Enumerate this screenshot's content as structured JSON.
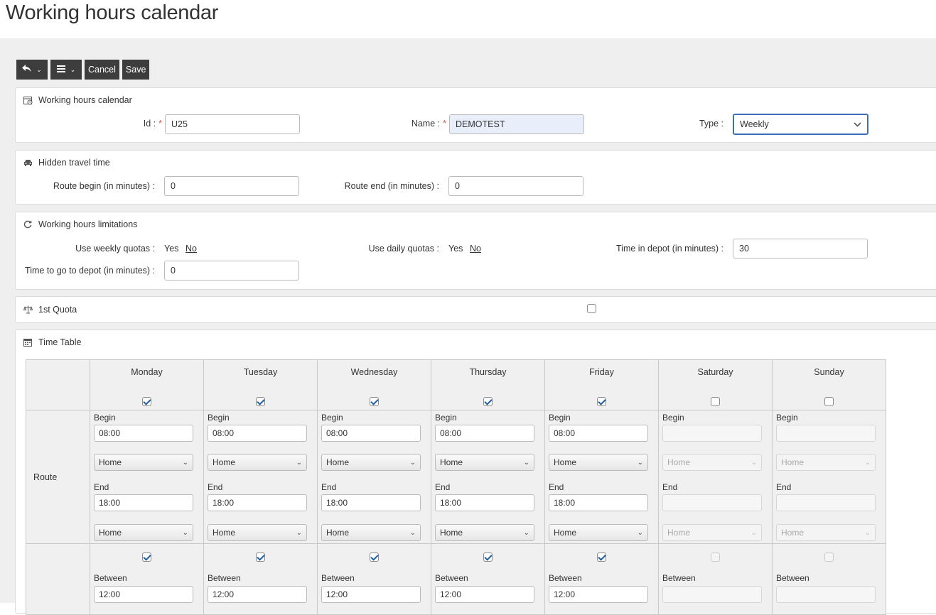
{
  "page": {
    "title": "Working hours calendar"
  },
  "toolbar": {
    "cancel": "Cancel",
    "save": "Save"
  },
  "general": {
    "title": "Working hours calendar",
    "id_label": "Id :",
    "id_value": "U25",
    "name_label": "Name :",
    "name_value": "DEMOTEST",
    "type_label": "Type :",
    "type_value": "Weekly"
  },
  "travel": {
    "title": "Hidden travel time",
    "route_begin_label": "Route begin (in minutes) :",
    "route_begin_value": "0",
    "route_end_label": "Route end (in minutes) :",
    "route_end_value": "0"
  },
  "limits": {
    "title": "Working hours limitations",
    "weekly_label": "Use weekly quotas :",
    "daily_label": "Use daily quotas :",
    "yes": "Yes",
    "no": "No",
    "depot_label": "Time in depot (in minutes) :",
    "depot_value": "30",
    "go_depot_label": "Time to go to depot (in minutes) :",
    "go_depot_value": "0"
  },
  "quota": {
    "title": "1st Quota",
    "checked": false
  },
  "timetable": {
    "title": "Time Table",
    "route_label": "Route",
    "begin_label": "Begin",
    "end_label": "End",
    "between_label": "Between",
    "days": [
      {
        "name": "Monday",
        "enabled": true,
        "begin": "08:00",
        "begin_loc": "Home",
        "end": "18:00",
        "end_loc": "Home",
        "break": "12:00"
      },
      {
        "name": "Tuesday",
        "enabled": true,
        "begin": "08:00",
        "begin_loc": "Home",
        "end": "18:00",
        "end_loc": "Home",
        "break": "12:00"
      },
      {
        "name": "Wednesday",
        "enabled": true,
        "begin": "08:00",
        "begin_loc": "Home",
        "end": "18:00",
        "end_loc": "Home",
        "break": "12:00"
      },
      {
        "name": "Thursday",
        "enabled": true,
        "begin": "08:00",
        "begin_loc": "Home",
        "end": "18:00",
        "end_loc": "Home",
        "break": "12:00"
      },
      {
        "name": "Friday",
        "enabled": true,
        "begin": "08:00",
        "begin_loc": "Home",
        "end": "18:00",
        "end_loc": "Home",
        "break": "12:00"
      },
      {
        "name": "Saturday",
        "enabled": false,
        "begin": "",
        "begin_loc": "Home",
        "end": "",
        "end_loc": "Home",
        "break": ""
      },
      {
        "name": "Sunday",
        "enabled": false,
        "begin": "",
        "begin_loc": "Home",
        "end": "",
        "end_loc": "Home",
        "break": ""
      }
    ]
  }
}
